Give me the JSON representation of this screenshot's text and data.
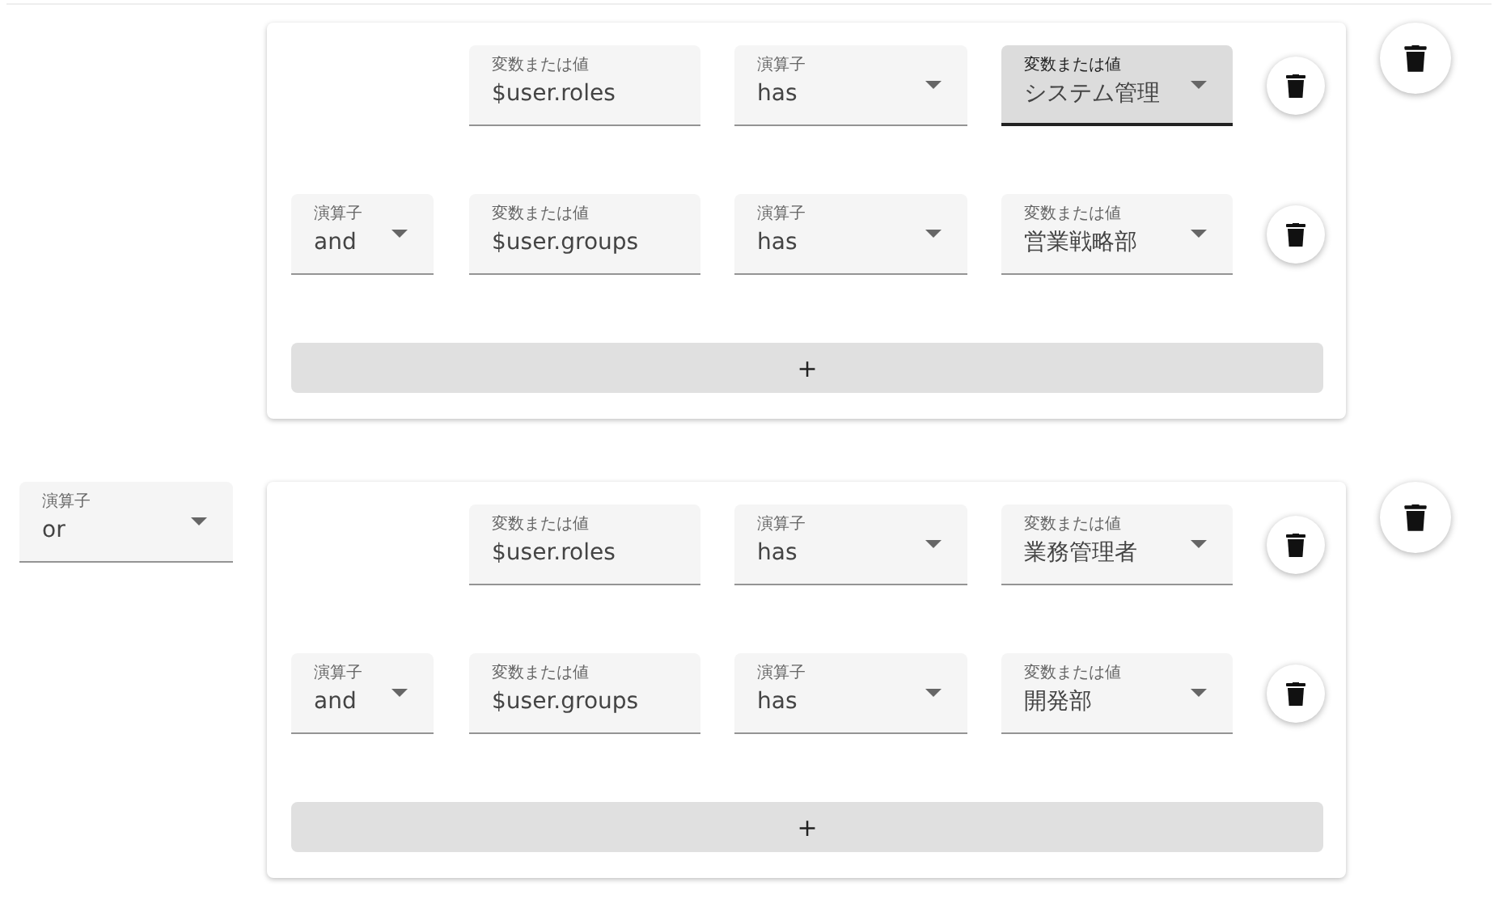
{
  "groups": [
    {
      "conditions": [
        {
          "left": {
            "label": "変数または値",
            "value": "$user.roles",
            "focused": false
          },
          "op": {
            "label": "演算子",
            "value": "has",
            "focused": false
          },
          "right": {
            "label": "変数または値",
            "value": "システム管理",
            "focused": true
          }
        },
        {
          "connector": {
            "label": "演算子",
            "value": "and",
            "focused": false
          },
          "left": {
            "label": "変数または値",
            "value": "$user.groups",
            "focused": false
          },
          "op": {
            "label": "演算子",
            "value": "has",
            "focused": false
          },
          "right": {
            "label": "変数または値",
            "value": "営業戦略部",
            "focused": false
          }
        }
      ],
      "add_button": "+"
    },
    {
      "operator": {
        "label": "演算子",
        "value": "or",
        "focused": false
      },
      "conditions": [
        {
          "left": {
            "label": "変数または値",
            "value": "$user.roles",
            "focused": false
          },
          "op": {
            "label": "演算子",
            "value": "has",
            "focused": false
          },
          "right": {
            "label": "変数または値",
            "value": "業務管理者",
            "focused": false
          }
        },
        {
          "connector": {
            "label": "演算子",
            "value": "and",
            "focused": false
          },
          "left": {
            "label": "変数または値",
            "value": "$user.groups",
            "focused": false
          },
          "op": {
            "label": "演算子",
            "value": "has",
            "focused": false
          },
          "right": {
            "label": "変数または値",
            "value": "開発部",
            "focused": false
          }
        }
      ],
      "add_button": "+"
    }
  ]
}
